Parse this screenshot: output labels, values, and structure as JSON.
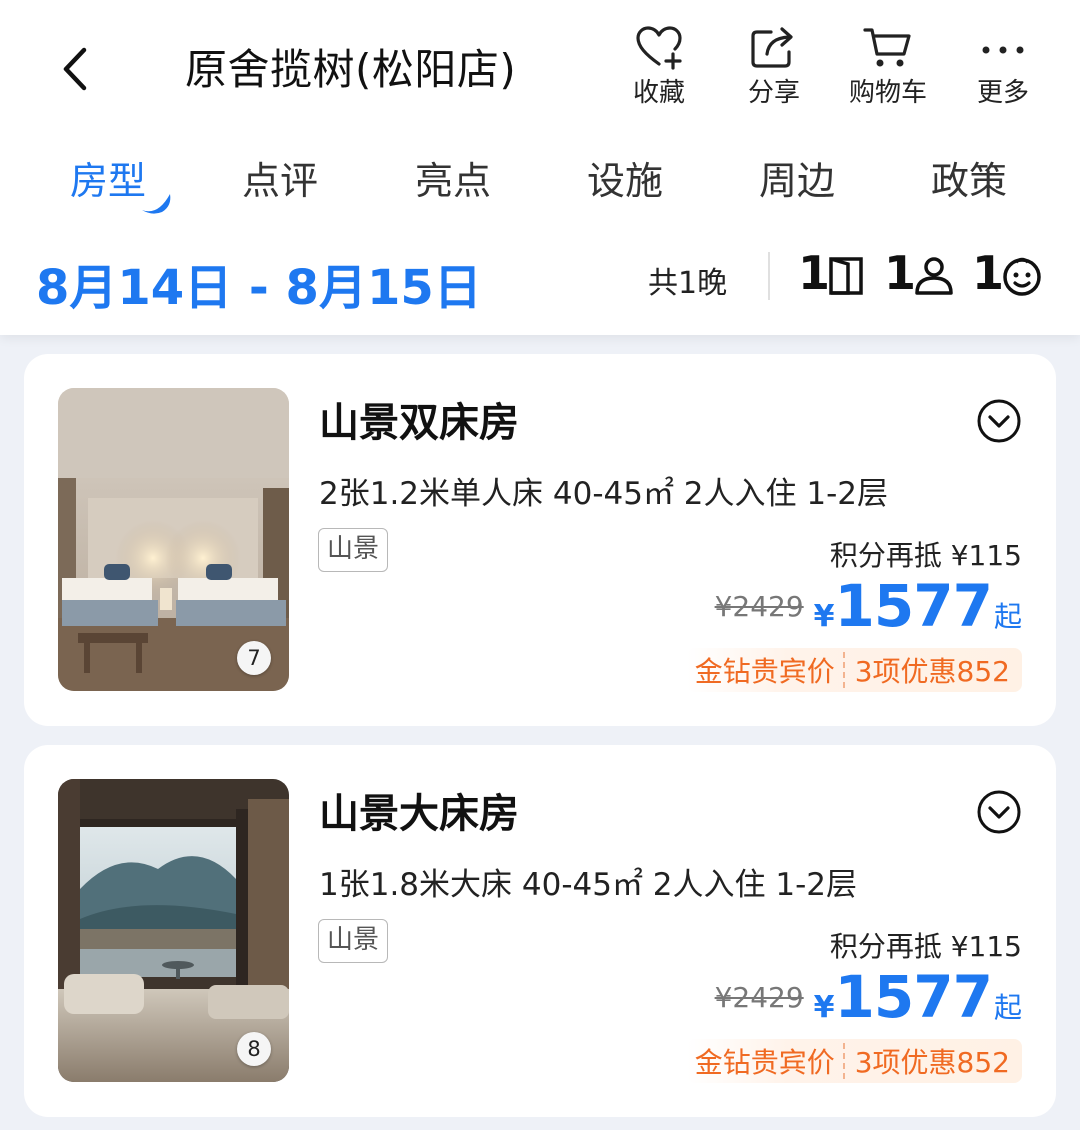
{
  "header": {
    "title": "原舍揽树(松阳店)",
    "actions": [
      {
        "label": "收藏",
        "icon": "heart-plus-icon"
      },
      {
        "label": "分享",
        "icon": "share-icon"
      },
      {
        "label": "购物车",
        "icon": "cart-icon"
      },
      {
        "label": "更多",
        "icon": "more-icon"
      }
    ]
  },
  "tabs": [
    "房型",
    "点评",
    "亮点",
    "设施",
    "周边",
    "政策"
  ],
  "active_tab": "房型",
  "booking": {
    "date_range": "8月14日 - 8月15日",
    "nights": "共1晚",
    "rooms": "1",
    "adults": "1",
    "children": "1"
  },
  "rooms": [
    {
      "name": "山景双床房",
      "spec": "2张1.2米单人床  40-45㎡  2人入住  1-2层",
      "tag": "山景",
      "photo_count": "7",
      "points_label": "积分再抵 ¥115",
      "orig_price": "¥2429",
      "currency": "¥",
      "price": "1577",
      "price_suffix": "起",
      "promo_label": "金钻贵宾价",
      "promo_detail": "3项优惠852"
    },
    {
      "name": "山景大床房",
      "spec": "1张1.8米大床  40-45㎡  2人入住  1-2层",
      "tag": "山景",
      "photo_count": "8",
      "points_label": "积分再抵 ¥115",
      "orig_price": "¥2429",
      "currency": "¥",
      "price": "1577",
      "price_suffix": "起",
      "promo_label": "金钻贵宾价",
      "promo_detail": "3项优惠852"
    }
  ],
  "colors": {
    "accent": "#1e78f0",
    "promo": "#f06a22",
    "background": "#eef1f7"
  }
}
